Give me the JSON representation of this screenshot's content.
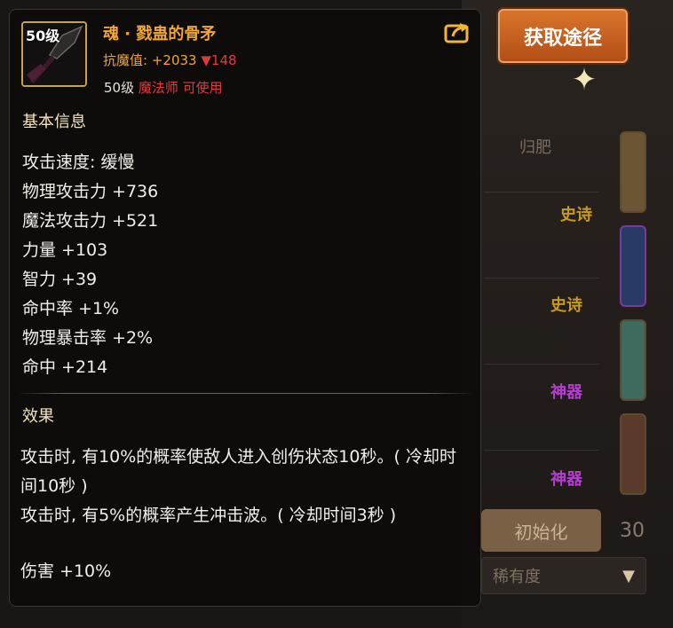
{
  "item": {
    "level_badge": "50级",
    "name": "魂 · 戮蛊的骨矛",
    "resist_label": "抗魔值: ",
    "resist_value": "+2033",
    "resist_delta": "▼148",
    "req_level": "50级",
    "req_class": "魔法师 可使用"
  },
  "sections": {
    "basic": "基本信息",
    "effect": "效果"
  },
  "stats": [
    "攻击速度: 缓慢",
    "物理攻击力 +736",
    "魔法攻击力 +521",
    "力量 +103",
    "智力 +39",
    "命中率 +1%",
    "物理暴击率 +2%",
    "命中 +214"
  ],
  "effects": {
    "line1": "攻击时, 有10%的概率使敌人进入创伤状态10秒。( 冷却时间10秒 )",
    "line2": "攻击时, 有5%的概率产生冲击波。( 冷却时间3秒 )",
    "damage": "伤害 +10%"
  },
  "acquire_button": "获取途径",
  "background": {
    "header": "归肥",
    "tags": [
      {
        "text": "史诗",
        "color": "#c99a1c"
      },
      {
        "text": "史诗",
        "color": "#c99a1c"
      },
      {
        "text": "神器",
        "color": "#b53ed0"
      },
      {
        "text": "神器",
        "color": "#b53ed0"
      }
    ],
    "reset": "初始化",
    "rarity": "稀有度",
    "count": "30"
  },
  "colors": {
    "gold": "#f2a733",
    "red": "#e23a3a",
    "button": "#c9611f"
  }
}
